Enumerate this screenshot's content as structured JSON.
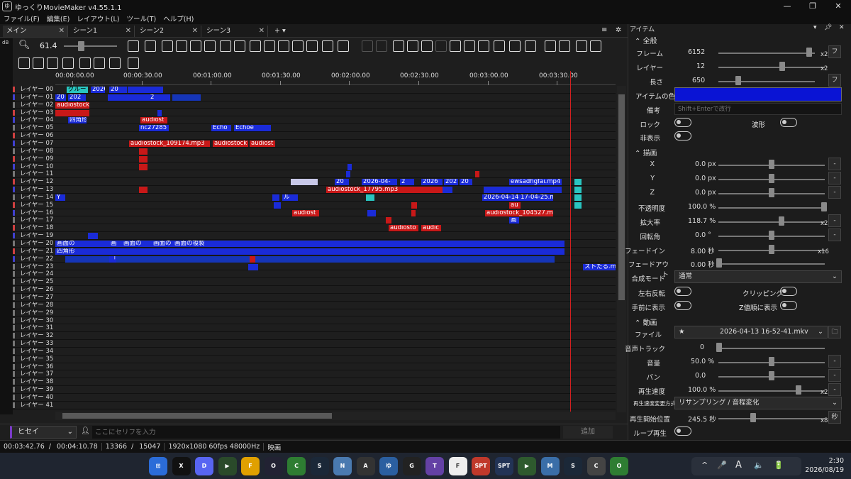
{
  "window": {
    "title": "ゆっくりMovieMaker v4.55.1.1",
    "logo": "ゆ"
  },
  "menu": [
    "ファイル(F)",
    "編集(E)",
    "レイアウト(L)",
    "ツール(T)",
    "ヘルプ(H)"
  ],
  "tabs": [
    {
      "label": "メイン"
    },
    {
      "label": "シーン1"
    },
    {
      "label": "シーン2"
    },
    {
      "label": "シーン3"
    }
  ],
  "tab_add": "+ ▾",
  "toolbar": {
    "zoom": "61.4",
    "db": "dB"
  },
  "ruler": [
    "00:00:00.00",
    "00:00:30.00",
    "00:01:00.00",
    "00:01:30.00",
    "00:02:00.00",
    "00:02:30.00",
    "00:03:00.00",
    "00:03:30.00"
  ],
  "layers": [
    "レイヤー 00",
    "レイヤー 01",
    "レイヤー 02",
    "レイヤー 03",
    "レイヤー 04",
    "レイヤー 05",
    "レイヤー 06",
    "レイヤー 07",
    "レイヤー 08",
    "レイヤー 09",
    "レイヤー 10",
    "レイヤー 11",
    "レイヤー 12",
    "レイヤー 13",
    "レイヤー 14",
    "レイヤー 15",
    "レイヤー 16",
    "レイヤー 17",
    "レイヤー 18",
    "レイヤー 19",
    "レイヤー 20",
    "レイヤー 21",
    "レイヤー 22",
    "レイヤー 23",
    "レイヤー 24",
    "レイヤー 25",
    "レイヤー 26",
    "レイヤー 27",
    "レイヤー 28",
    "レイヤー 29",
    "レイヤー 30",
    "レイヤー 31",
    "レイヤー 32",
    "レイヤー 33",
    "レイヤー 34",
    "レイヤー 35",
    "レイヤー 36",
    "レイヤー 37",
    "レイヤー 38",
    "レイヤー 39",
    "レイヤー 40",
    "レイヤー 41"
  ],
  "clip_texts": {
    "c00a": "グルー",
    "c00b": "2026",
    "c00c": "20",
    "c01a": "20",
    "c01b": "202",
    "c01c": "2",
    "c02a": "audiostock",
    "c04a": "四角形",
    "c04b": "audiost",
    "c05a": "nc27285",
    "c05b": "Echo",
    "c05c": "Echoe",
    "c07a": "audiostock_109174.mp3",
    "c07b": "audiostock",
    "c07c": "audiost",
    "c12a": "20",
    "c12b": "2026-04-",
    "c12c": "2",
    "c12d": "2026",
    "c12e": "202",
    "c12f": "20",
    "c12g": "ewsadhgfai.mp4",
    "c13a": "audiostock_17795.mp3",
    "c14a": "Y",
    "c14b": "ル",
    "c14c": "2026-04-14 17-04-25.mk",
    "c15a": "au",
    "c16a": "audiost",
    "c16b": "audiostock_104527.mp",
    "c17a": "画",
    "c18a": "audiosto",
    "c18b": "audic",
    "c20a": "画面の",
    "c20b": "画",
    "c20c": "画面の",
    "c20d": "画面の",
    "c20e": "画面の複製",
    "c21a": "四角形",
    "c22a": "「",
    "c23a": "ストたる.mp"
  },
  "speech": {
    "character": "ヒセイ",
    "placeholder": "ここにセリフを入力",
    "add": "追加"
  },
  "status": [
    "00:03:42.76",
    "/",
    "00:04:10.78",
    "13366",
    "/",
    "15047",
    "1920x1080 60fps 48000Hz",
    "映画"
  ],
  "panel": {
    "title": "アイテム",
    "sect_all": "全般",
    "frame_label": "フレーム",
    "frame_value": "6152",
    "layer_label": "レイヤー",
    "layer_value": "12",
    "length_label": "長さ",
    "length_value": "650",
    "color_label": "アイテムの色",
    "item_color": "#0a14d4",
    "memo_label": "備考",
    "memo_placeholder": "Shift+Enterで改行",
    "lock_label": "ロック",
    "waveform_label": "波形",
    "hidden_label": "非表示",
    "sect_draw": "描画",
    "x_label": "X",
    "x_value": "0.0 px",
    "y_label": "Y",
    "y_value": "0.0 px",
    "z_label": "Z",
    "z_value": "0.0 px",
    "opacity_label": "不透明度",
    "opacity_value": "100.0 %",
    "zoom_label": "拡大率",
    "zoom_value": "118.7 %",
    "rotation_label": "回転角",
    "rotation_value": "0.0 °",
    "fadein_label": "フェードイン",
    "fadein_value": "8.00 秒",
    "fadein_mult": "x16",
    "fadeout_label": "フェードアウト",
    "fadeout_value": "0.00 秒",
    "blend_label": "合成モード",
    "blend_value": "通常",
    "flip_label": "左右反転",
    "clipping_label": "クリッピング",
    "front_label": "手前に表示",
    "zsort_label": "Z値順に表示",
    "sect_video": "動画",
    "file_label": "ファイル",
    "file_value": "2026-04-13 16-52-41.mkv",
    "track_label": "音声トラック",
    "track_value": "0",
    "volume_label": "音量",
    "volume_value": "50.0 %",
    "pan_label": "パン",
    "pan_value": "0.0",
    "speed_label": "再生速度",
    "speed_value": "100.0 %",
    "speedmode_label": "再生速度変更方式",
    "speedmode_value": "リサンプリング / 音程変化",
    "start_label": "再生開始位置",
    "start_value": "245.5 秒",
    "start_unit": "秒",
    "loop_label": "ループ再生",
    "x2": "x2",
    "x8": "x8",
    "fu": "フ",
    "dash": "-",
    "star": "★"
  },
  "taskbar": {
    "icons": [
      "⊞",
      "X",
      "D",
      "▶",
      "F",
      "O",
      "C",
      "S",
      "N",
      "A",
      "ゆ",
      "G",
      "T",
      "F",
      "SPT",
      "SPT",
      "▶",
      "M",
      "S",
      "C",
      "O"
    ],
    "clock_time": "2:30",
    "clock_date": "2026/08/19",
    "tray": [
      "^",
      "🎤",
      "A",
      "🔈",
      "🔋"
    ]
  }
}
